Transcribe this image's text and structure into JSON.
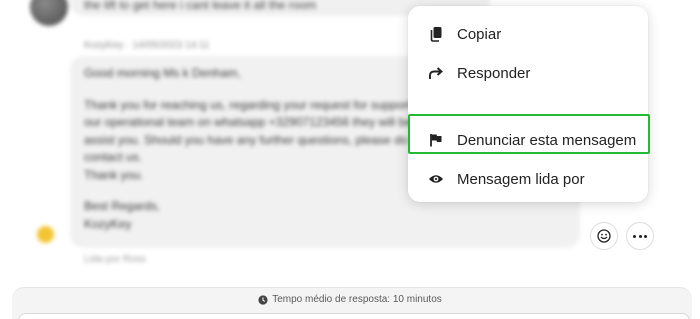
{
  "chat": {
    "previous_message": "the lift to get here i cant leave it all the room",
    "sender_meta": "KozyKey · 14/05/2023 14:11",
    "message_lines": [
      "Good morning Ms k Denham,",
      "",
      "Thank you for reaching us, regarding your request for support we can put in touch with",
      "our operational team on whatsapp +32907123456 they will be more than happy to",
      "assist you. Should you have any further questions, please do not hesitate to",
      "contact us.",
      "Thank you.",
      "",
      "Best Regards,",
      "KozyKey"
    ],
    "read_label": "Lida por Ross"
  },
  "context_menu": {
    "items": [
      {
        "label": "Copiar",
        "icon": "copy-icon"
      },
      {
        "label": "Responder",
        "icon": "reply-arrow-icon"
      },
      {
        "label": "Denunciar esta mensagem",
        "icon": "flag-icon"
      },
      {
        "label": "Mensagem lida por",
        "icon": "eye-icon"
      }
    ],
    "highlight_color": "#22bb33"
  },
  "actions": {
    "emoji_icon": "smiley-icon",
    "more_icon": "more-dots-icon"
  },
  "footer": {
    "response_time": "Tempo médio de resposta: 10 minutos",
    "icon": "clock-icon"
  }
}
